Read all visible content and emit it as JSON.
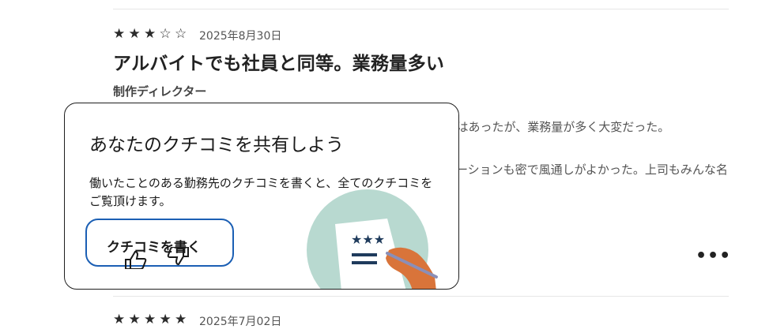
{
  "review1": {
    "rating": 3,
    "max_rating": 5,
    "date": "2025年8月30日",
    "title": "アルバイトでも社員と同等。業務量多い",
    "job_title": "制作ディレクター",
    "paragraph1": "アルバイト採用でしたが、社員と業務内容も量も同等。やりがいはあったが、業務量が多く大変だった。",
    "paragraph2": "社内での表彰などもあり活気があり、働くチーム内のコミュニケーションも密で風通しがよかった。上司もみんな名前で呼んでいただけ距離の近さを感じました。"
  },
  "review2": {
    "rating": 5,
    "max_rating": 5,
    "date": "2025年7月02日"
  },
  "share_prompt": {
    "heading": "あなたのクチコミを共有しよう",
    "description": "働いたことのある勤務先のクチコミを書くと、全てのクチコミをご覧頂けます。",
    "button_label": "クチコミを書く"
  },
  "more_label": "•••",
  "icons": {
    "more": "ellipsis-icon",
    "thumbs_up": "thumbs-up-icon",
    "thumbs_down": "thumbs-down-icon"
  },
  "colors": {
    "button_border": "#1b5fb4",
    "illustration_circle": "#b8d9d0",
    "hand": "#d9743a",
    "star_icon": "#1f3b5c"
  }
}
